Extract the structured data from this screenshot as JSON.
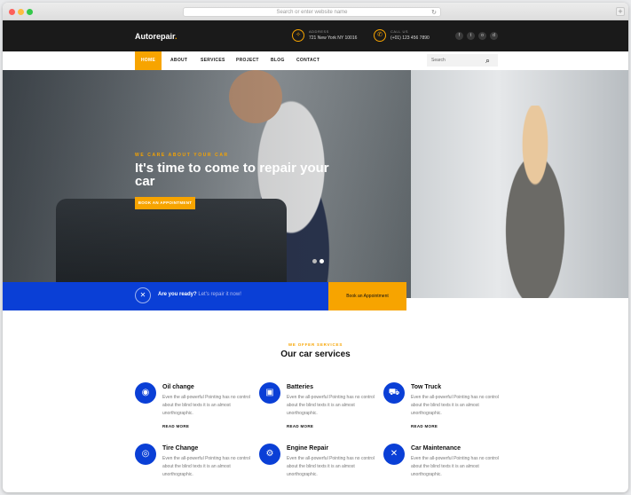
{
  "browser": {
    "url_placeholder": "Search or enter website name",
    "reload_glyph": "↻",
    "new_tab_glyph": "+"
  },
  "topbar": {
    "logo_main": "Autorepair",
    "logo_dot": ".",
    "address_label": "ADDRESS",
    "address_value": "721 New York NY 10016",
    "call_label": "CALL US",
    "call_value": "(+01) 123 456 7890",
    "socials": [
      "f",
      "t",
      "o",
      "d"
    ]
  },
  "nav": {
    "items": [
      "HOME",
      "ABOUT",
      "SERVICES",
      "PROJECT",
      "BLOG",
      "CONTACT"
    ],
    "search_placeholder": "Search",
    "search_glyph": "🔍"
  },
  "hero": {
    "kicker": "WE CARE ABOUT YOUR CAR",
    "title": "It's time to come to repair your car",
    "cta": "BOOK AN APPOINTMENT"
  },
  "bluebar": {
    "text": "Are you ready?",
    "sub": "Let's repair it now!",
    "button": "Book an Appointment"
  },
  "services": {
    "kicker": "WE OFFER SERVICES",
    "title": "Our car services",
    "read_more": "READ MORE",
    "items": [
      {
        "title": "Oil change",
        "desc": "Even the all-powerful Pointing has no control about the blind texts it is an almost unorthographic.",
        "icon": "oil-can-icon",
        "glyph": "◉"
      },
      {
        "title": "Batteries",
        "desc": "Even the all-powerful Pointing has no control about the blind texts it is an almost unorthographic.",
        "icon": "battery-icon",
        "glyph": "▣"
      },
      {
        "title": "Tow Truck",
        "desc": "Even the all-powerful Pointing has no control about the blind texts it is an almost unorthographic.",
        "icon": "tow-truck-icon",
        "glyph": "⛟"
      },
      {
        "title": "Tire Change",
        "desc": "Even the all-powerful Pointing has no control about the blind texts it is an almost unorthographic.",
        "icon": "tire-icon",
        "glyph": "◎"
      },
      {
        "title": "Engine Repair",
        "desc": "Even the all-powerful Pointing has no control about the blind texts it is an almost unorthographic.",
        "icon": "engine-icon",
        "glyph": "⚙"
      },
      {
        "title": "Car Maintenance",
        "desc": "Even the all-powerful Pointing has no control about the blind texts it is an almost unorthographic.",
        "icon": "wrench-icon",
        "glyph": "✕"
      }
    ]
  },
  "colors": {
    "accent": "#f7a400",
    "blue": "#0a3fd6",
    "dark": "#1a1a1a"
  }
}
